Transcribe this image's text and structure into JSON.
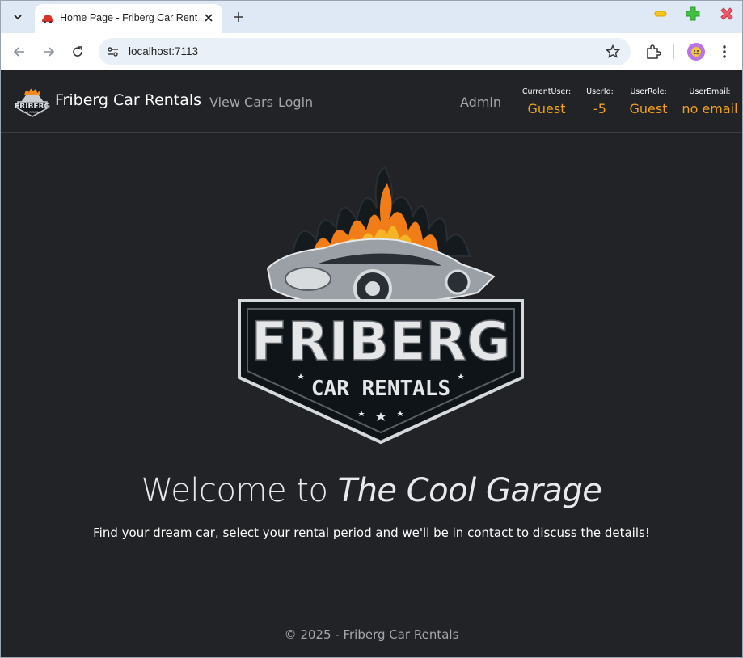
{
  "browser": {
    "tab_title": "Home Page - Friberg Car Rentals",
    "url": "localhost:7113"
  },
  "site": {
    "brand": "Friberg Car Rentals",
    "nav": {
      "view_cars": "View Cars",
      "login": "Login",
      "admin": "Admin"
    },
    "user_info": {
      "current_user_label": "CurrentUser:",
      "current_user_value": "Guest",
      "user_id_label": "UserId:",
      "user_id_value": "-5",
      "user_role_label": "UserRole:",
      "user_role_value": "Guest",
      "user_email_label": "UserEmail:",
      "user_email_value": "no email"
    },
    "logo": {
      "big_text": "FRIBERG",
      "small_text": "CAR RENTALS"
    },
    "hero": {
      "welcome_prefix": "Welcome to",
      "welcome_emphasis": "The Cool Garage",
      "tagline": "Find your dream car, select your rental period and we'll be in contact to discuss the details!"
    },
    "footer": "© 2025 - Friberg Car Rentals"
  },
  "colors": {
    "page_bg": "#212327",
    "accent_orange": "#f0a020",
    "nav_link": "#a3a6ab"
  },
  "icons": [
    "tab-list-icon",
    "car-favicon-icon",
    "close-icon",
    "plus-icon",
    "minimize-icon",
    "maximize-icon",
    "close-window-icon",
    "back-arrow-icon",
    "forward-arrow-icon",
    "reload-icon",
    "site-info-icon",
    "star-icon",
    "extensions-icon",
    "profile-icon",
    "kebab-menu-icon"
  ]
}
